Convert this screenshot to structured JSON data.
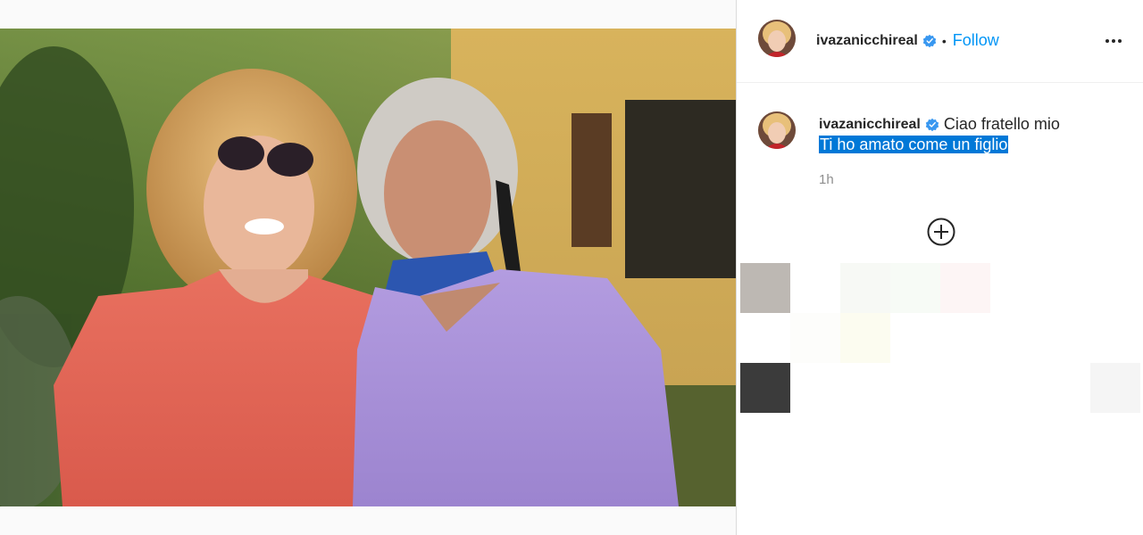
{
  "post": {
    "username": "ivazanicchireal",
    "separator": "•",
    "follow_label": "Follow",
    "more_icon": "more-horizontal-icon"
  },
  "caption": {
    "username": "ivazanicchireal",
    "line1": "Ciao fratello mio",
    "line2": "Ti ho amato come un figlio",
    "timestamp": "1h"
  },
  "colors": {
    "link": "#0095f6",
    "verified": "#3897f0",
    "selection": "#0078d7",
    "muted": "#8e8e8e"
  },
  "load_more_icon": "plus-circle-icon",
  "thumbnails": [
    {
      "color": "#bdb8b3"
    },
    {
      "color": "#f7f9f5"
    },
    {
      "color": "#f7fbf6"
    },
    {
      "color": "#fdf5f5"
    },
    {
      "color": "#fdfdfb"
    },
    {
      "color": "#fcfcf0"
    },
    {
      "color": "#3b3b3b"
    },
    {
      "color": "#f5f5f5"
    }
  ]
}
